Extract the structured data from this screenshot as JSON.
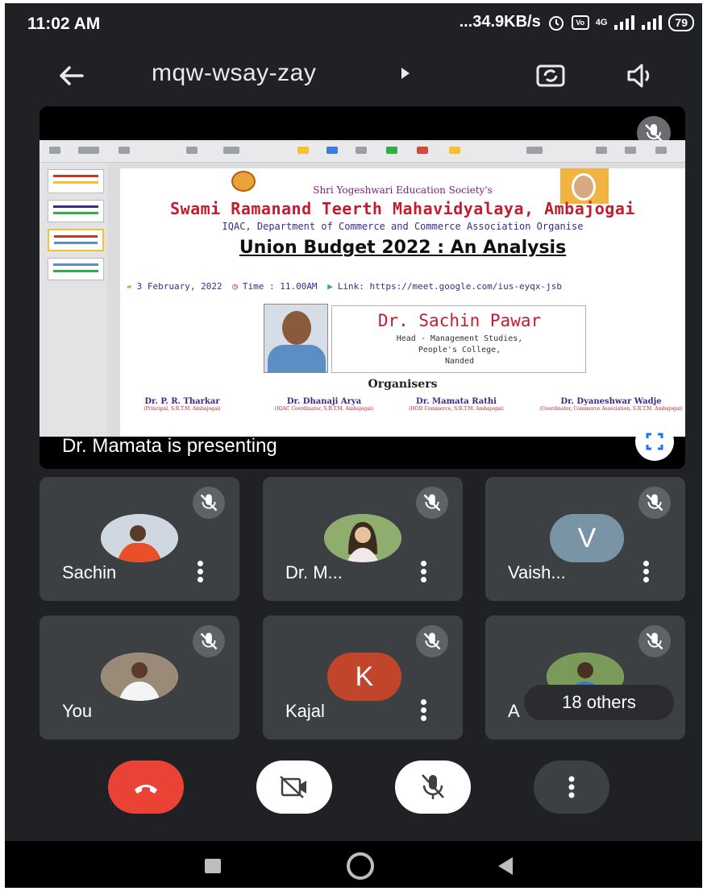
{
  "status_bar": {
    "time": "11:02 AM",
    "network_speed": "...34.9KB/s",
    "signal_label": "4G",
    "battery": "79"
  },
  "meeting": {
    "code": "mqw-wsay-zay"
  },
  "presentation": {
    "presenting_text": "Dr. Mamata is presenting",
    "slide": {
      "society": "Shri Yogeshwari Education Society's",
      "college": "Swami Ramanand Teerth Mahavidyalaya, Ambajogai",
      "iqac": "IQAC, Department of Commerce and Commerce Association Organise",
      "event_title": "Union Budget 2022 : An Analysis",
      "date": "3 February, 2022",
      "time": "Time : 11.00AM",
      "link": "Link: https://meet.google.com/ius-eyqx-jsb",
      "speaker_name": "Dr. Sachin Pawar",
      "speaker_role_1": "Head - Management Studies,",
      "speaker_role_2": "People's College,",
      "speaker_role_3": "Nanded",
      "organisers_heading": "Organisers",
      "organisers": [
        {
          "name": "Dr. P. R. Tharkar",
          "role": "(Principal, S.R.T.M. Ambajogai)"
        },
        {
          "name": "Dr. Dhanaji Arya",
          "role": "(IQAC Coordinator, S.R.T.M. Ambajogai)"
        },
        {
          "name": "Dr. Mamata Rathi",
          "role": "(HOD Commerce, S.R.T.M. Ambajogai)"
        },
        {
          "name": "Dr. Dyaneshwar Wadje",
          "role": "(Coordinator, Commerce Association, S.R.T.M. Ambajogai)"
        }
      ]
    }
  },
  "participants": [
    {
      "name": "Sachin",
      "avatar": "photo"
    },
    {
      "name": "Dr. M...",
      "avatar": "photo"
    },
    {
      "name": "Vaish...",
      "avatar": "letter",
      "initial": "V"
    },
    {
      "name": "You",
      "avatar": "photo"
    },
    {
      "name": "Kajal",
      "avatar": "letter",
      "initial": "K"
    },
    {
      "name": "A",
      "avatar": "photo"
    }
  ],
  "others_badge": "18 others",
  "colors": {
    "background": "#202124",
    "tile": "#3c4043",
    "end_call": "#ea4335",
    "avatar_v": "#7995a5",
    "avatar_k": "#c0452a"
  }
}
